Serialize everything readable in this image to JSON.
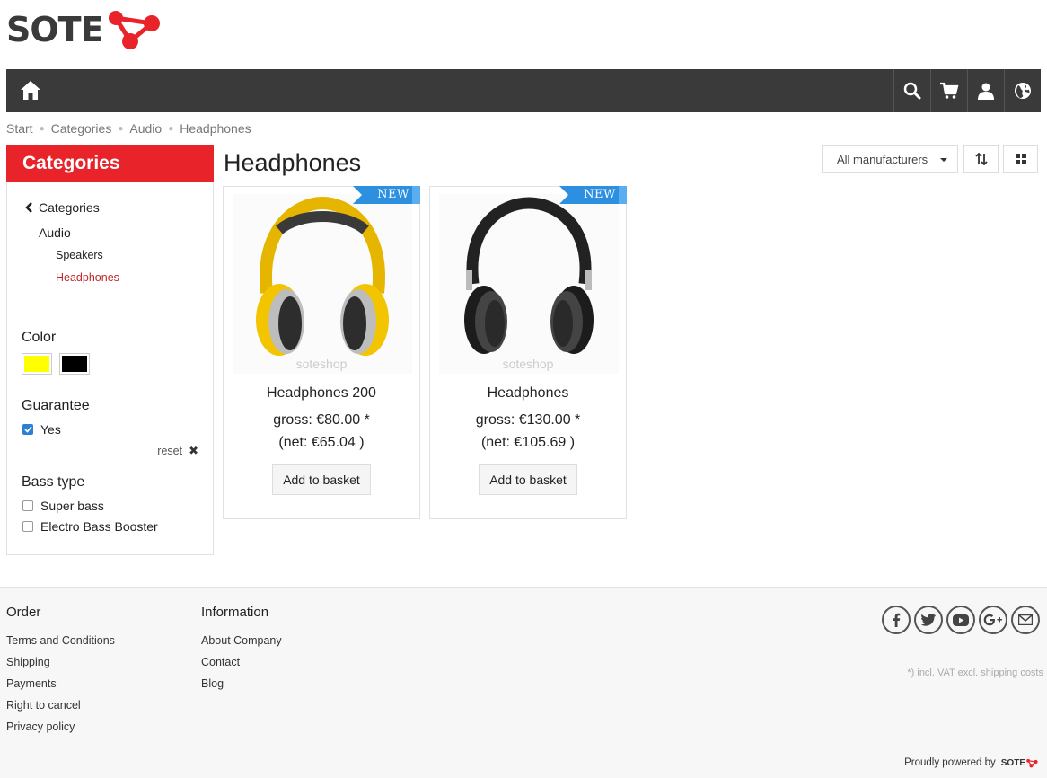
{
  "brand": {
    "logo_text": "SOTE",
    "accent": "#e8232a"
  },
  "navbar": {
    "home_icon": "home-icon",
    "icons": [
      "search-icon",
      "cart-icon",
      "user-icon",
      "globe-icon"
    ]
  },
  "breadcrumb": [
    "Start",
    "Categories",
    "Audio",
    "Headphones"
  ],
  "sidebar": {
    "title": "Categories",
    "tree": {
      "back": "Categories",
      "parent": "Audio",
      "children": [
        "Speakers",
        "Headphones"
      ],
      "active": "Headphones"
    },
    "filters": {
      "color": {
        "title": "Color",
        "swatches": [
          "#ffff00",
          "#000000"
        ]
      },
      "guarantee": {
        "title": "Guarantee",
        "options": [
          {
            "label": "Yes",
            "checked": true
          }
        ],
        "reset": "reset"
      },
      "bass": {
        "title": "Bass type",
        "options": [
          {
            "label": "Super bass",
            "checked": false
          },
          {
            "label": "Electro Bass Booster",
            "checked": false
          }
        ]
      }
    }
  },
  "main": {
    "title": "Headphones",
    "manufacturer_select": "All manufacturers",
    "products": [
      {
        "name": "Headphones 200",
        "badge": "NEW",
        "watermark": "soteshop",
        "gross": "gross: €80.00 *",
        "net": "(net: €65.04 )",
        "button": "Add to basket",
        "color": "yellow"
      },
      {
        "name": "Headphones",
        "badge": "NEW",
        "watermark": "soteshop",
        "gross": "gross: €130.00 *",
        "net": "(net: €105.69 )",
        "button": "Add to basket",
        "color": "black"
      }
    ]
  },
  "footer": {
    "order": {
      "title": "Order",
      "links": [
        "Terms and Conditions",
        "Shipping",
        "Payments",
        "Right to cancel",
        "Privacy policy"
      ]
    },
    "information": {
      "title": "Information",
      "links": [
        "About Company",
        "Contact",
        "Blog"
      ]
    },
    "socials": [
      "facebook-icon",
      "twitter-icon",
      "youtube-icon",
      "google-plus-icon",
      "email-icon"
    ],
    "vat_note": "*) incl. VAT excl. shipping costs",
    "powered_by": "Proudly powered by",
    "powered_logo": "SOTE"
  }
}
